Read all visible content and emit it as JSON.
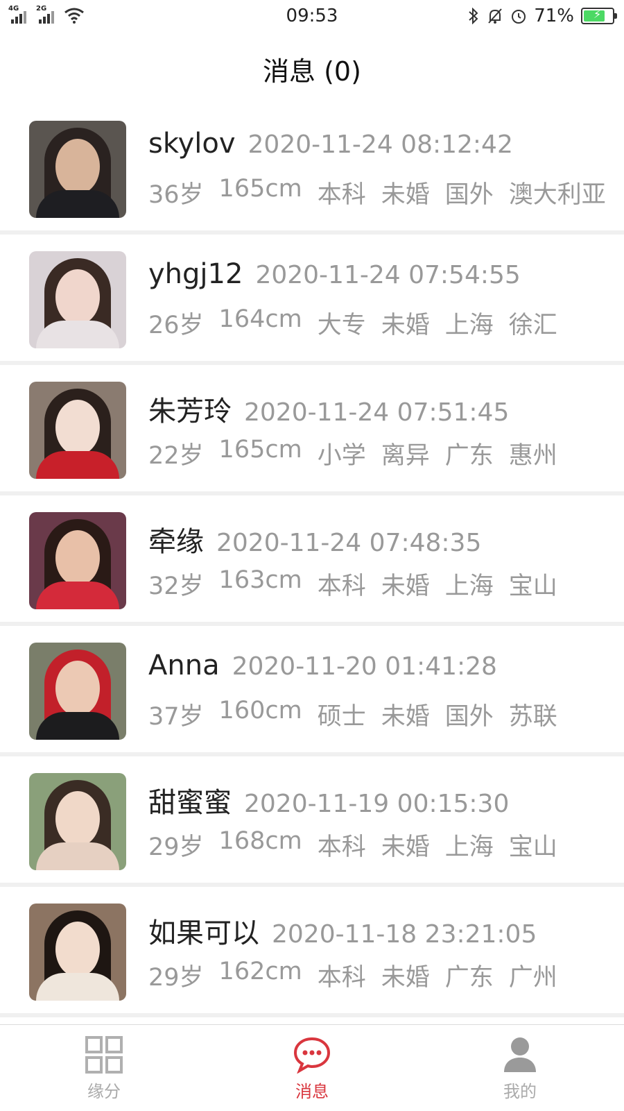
{
  "status_bar": {
    "net1": "4G",
    "net2": "2G",
    "time": "09:53",
    "battery_pct": "71%",
    "icons": [
      "bluetooth-icon",
      "mute-bell-icon",
      "alarm-icon",
      "battery-icon"
    ]
  },
  "header": {
    "title": "消息 (0)"
  },
  "messages": [
    {
      "name": "skylov",
      "time": "2020-11-24 08:12:42",
      "age": "36岁",
      "height": "165cm",
      "edu": "本科",
      "marital": "未婚",
      "region": "国外",
      "city": "澳大利亚"
    },
    {
      "name": "yhgj12",
      "time": "2020-11-24 07:54:55",
      "age": "26岁",
      "height": "164cm",
      "edu": "大专",
      "marital": "未婚",
      "region": "上海",
      "city": "徐汇"
    },
    {
      "name": "朱芳玲",
      "time": "2020-11-24 07:51:45",
      "age": "22岁",
      "height": "165cm",
      "edu": "小学",
      "marital": "离异",
      "region": "广东",
      "city": "惠州"
    },
    {
      "name": "牵缘",
      "time": "2020-11-24 07:48:35",
      "age": "32岁",
      "height": "163cm",
      "edu": "本科",
      "marital": "未婚",
      "region": "上海",
      "city": "宝山"
    },
    {
      "name": "Anna",
      "time": "2020-11-20 01:41:28",
      "age": "37岁",
      "height": "160cm",
      "edu": "硕士",
      "marital": "未婚",
      "region": "国外",
      "city": "苏联"
    },
    {
      "name": "甜蜜蜜",
      "time": "2020-11-19 00:15:30",
      "age": "29岁",
      "height": "168cm",
      "edu": "本科",
      "marital": "未婚",
      "region": "上海",
      "city": "宝山"
    },
    {
      "name": "如果可以",
      "time": "2020-11-18 23:21:05",
      "age": "29岁",
      "height": "162cm",
      "edu": "本科",
      "marital": "未婚",
      "region": "广东",
      "city": "广州"
    }
  ],
  "tabs": [
    {
      "label": "缘分",
      "icon": "grid-icon",
      "active": false
    },
    {
      "label": "消息",
      "icon": "chat-bubble-icon",
      "active": true
    },
    {
      "label": "我的",
      "icon": "person-icon",
      "active": false
    }
  ],
  "colors": {
    "accent": "#d9363e",
    "muted": "#999999",
    "tab_inactive": "#aaaaaa"
  }
}
